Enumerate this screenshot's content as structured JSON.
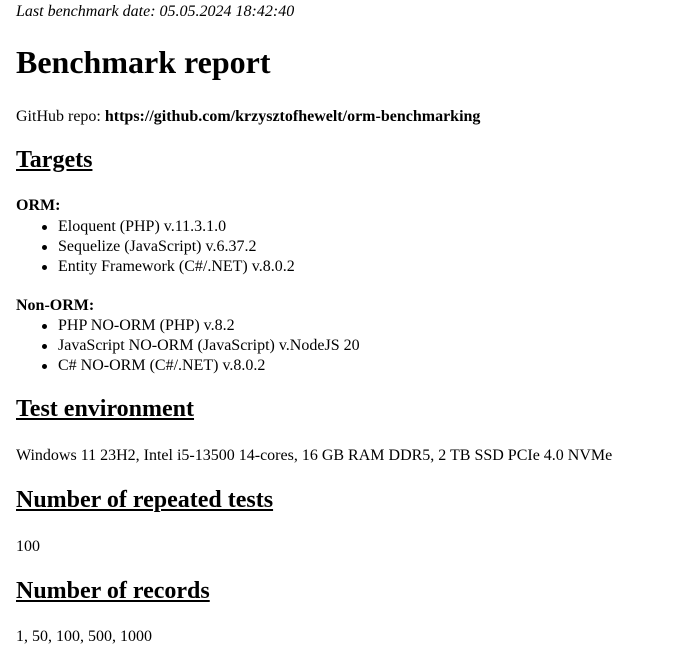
{
  "header": {
    "last_benchmark_date": "Last benchmark date: 05.05.2024 18:42:40"
  },
  "title": "Benchmark report",
  "repo": {
    "label": "GitHub repo: ",
    "url": "https://github.com/krzysztofhewelt/orm-benchmarking"
  },
  "targets": {
    "heading": "Targets",
    "orm": {
      "label": "ORM:",
      "items": [
        "Eloquent (PHP) v.11.3.1.0",
        "Sequelize (JavaScript) v.6.37.2",
        "Entity Framework (C#/.NET) v.8.0.2"
      ]
    },
    "non_orm": {
      "label": "Non-ORM:",
      "items": [
        "PHP NO-ORM (PHP) v.8.2",
        "JavaScript NO-ORM (JavaScript) v.NodeJS 20",
        "C# NO-ORM (C#/.NET) v.8.0.2"
      ]
    }
  },
  "environment": {
    "heading": "Test environment",
    "text": "Windows 11 23H2, Intel i5-13500 14-cores, 16 GB RAM DDR5, 2 TB SSD PCIe 4.0 NVMe"
  },
  "repeated_tests": {
    "heading": "Number of repeated tests",
    "value": "100"
  },
  "records": {
    "heading": "Number of records",
    "value": "1, 50, 100, 500, 1000"
  }
}
